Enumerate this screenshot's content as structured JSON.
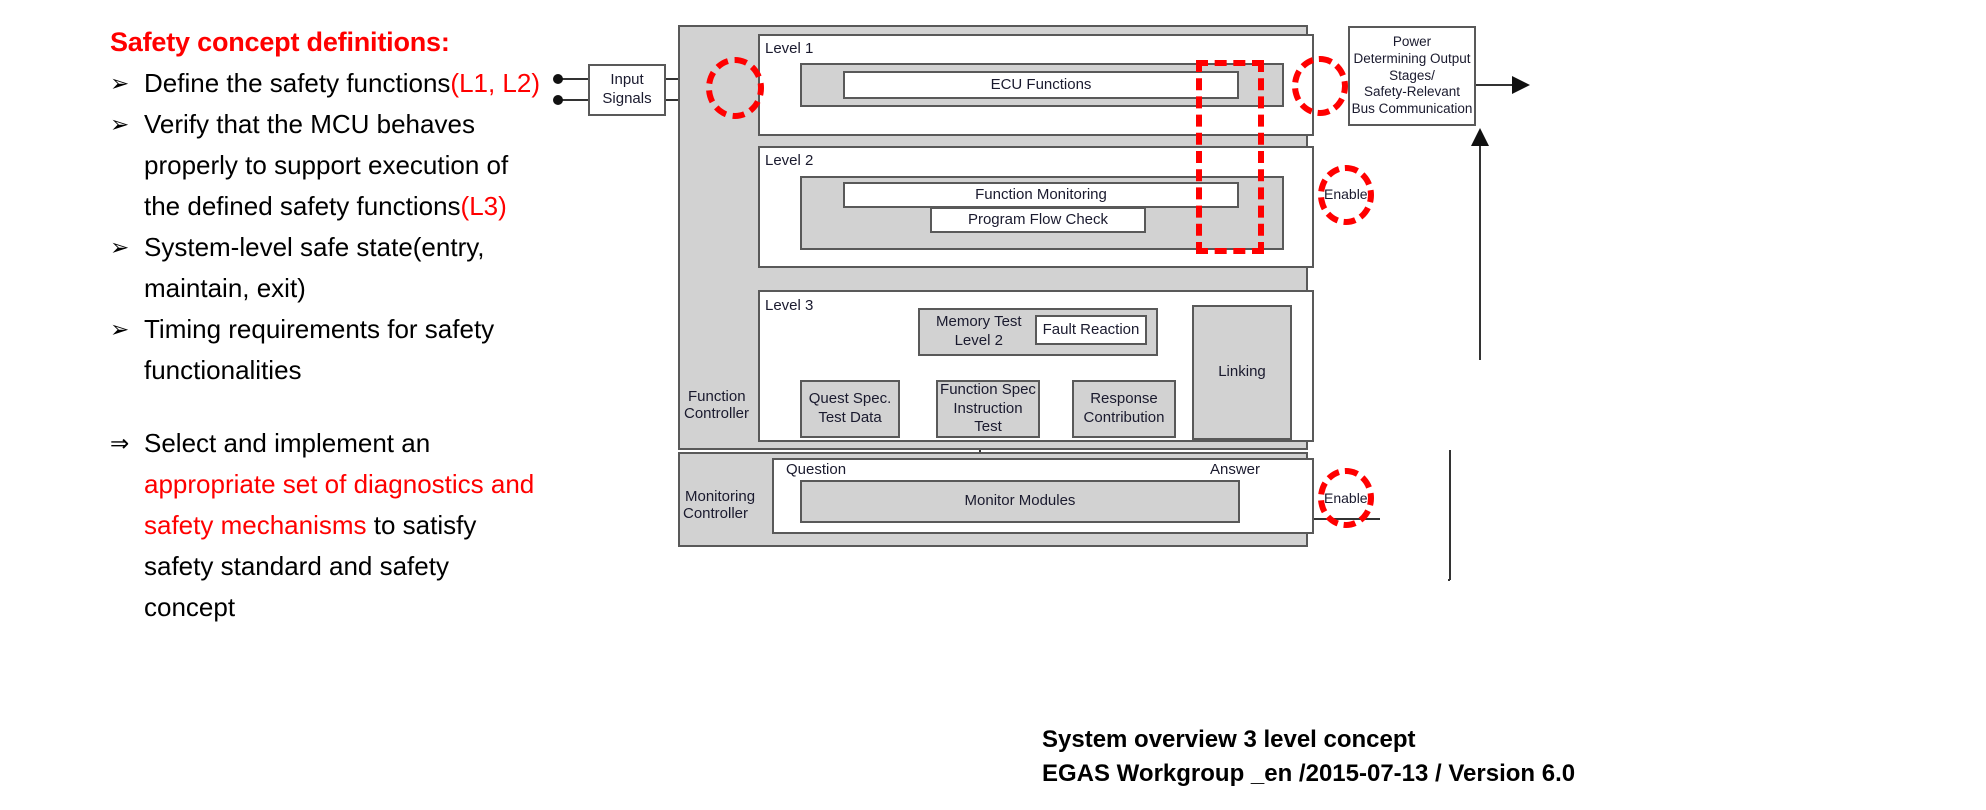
{
  "slide": {
    "heading": "Safety concept definitions:",
    "bullets": [
      {
        "marker": "➢",
        "lines": [
          {
            "parts": [
              {
                "text": "Define the safety functions",
                "color": "black"
              },
              {
                "text": "(L1, L2)",
                "color": "red"
              }
            ]
          }
        ]
      },
      {
        "marker": "➢",
        "lines": [
          {
            "parts": [
              {
                "text": "Verify that the MCU behaves",
                "color": "black"
              }
            ]
          },
          {
            "parts": [
              {
                "text": "properly to support execution of",
                "color": "black"
              }
            ]
          },
          {
            "parts": [
              {
                "text": "the defined safety functions",
                "color": "black"
              },
              {
                "text": "(L3)",
                "color": "red"
              }
            ]
          }
        ]
      },
      {
        "marker": "➢",
        "lines": [
          {
            "parts": [
              {
                "text": "System-level safe state(entry,",
                "color": "black"
              }
            ]
          },
          {
            "parts": [
              {
                "text": "maintain, exit)",
                "color": "black"
              }
            ]
          }
        ]
      },
      {
        "marker": "➢",
        "lines": [
          {
            "parts": [
              {
                "text": "Timing requirements for safety",
                "color": "black"
              }
            ]
          },
          {
            "parts": [
              {
                "text": "functionalities",
                "color": "black"
              }
            ]
          }
        ]
      }
    ],
    "conclusion": {
      "marker": "⇒",
      "lines": [
        {
          "parts": [
            {
              "text": "Select and implement an",
              "color": "black"
            }
          ]
        },
        {
          "parts": [
            {
              "text": "appropriate set of diagnostics and",
              "color": "red"
            }
          ]
        },
        {
          "parts": [
            {
              "text": "safety mechanisms",
              "color": "red"
            },
            {
              "text": " to satisfy",
              "color": "black"
            }
          ]
        },
        {
          "parts": [
            {
              "text": "safety standard and safety",
              "color": "black"
            }
          ]
        },
        {
          "parts": [
            {
              "text": "concept",
              "color": "black"
            }
          ]
        }
      ]
    }
  },
  "diagram": {
    "input_signals": "Input\nSignals",
    "input_signals_line1": "Input",
    "input_signals_line2": "Signals",
    "level1_label": "Level 1",
    "level2_label": "Level 2",
    "level3_label": "Level 3",
    "ecu_functions": "ECU Functions",
    "function_monitoring": "Function Monitoring",
    "program_flow_check": "Program Flow Check",
    "memory_test_level2_line1": "Memory Test",
    "memory_test_level2_line2": "Level 2",
    "fault_reaction": "Fault Reaction",
    "quest_spec_line1": "Quest Spec.",
    "quest_spec_line2": "Test Data",
    "function_spec_line1": "Function Spec",
    "function_spec_line2": "Instruction Test",
    "response_line1": "Response",
    "response_line2": "Contribution",
    "linking": "Linking",
    "function_controller_line1": "Function",
    "function_controller_line2": "Controller",
    "monitoring_controller_line1": "Monitoring",
    "monitoring_controller_line2": "Controller",
    "monitor_modules": "Monitor Modules",
    "question": "Question",
    "answer": "Answer",
    "enable_top": "Enable",
    "enable_bottom": "Enable",
    "power_box_line1": "Power",
    "power_box_line2": "Determining Output",
    "power_box_line3": "Stages/",
    "power_box_line4": "Safety-Relevant",
    "power_box_line5": "Bus Communication"
  },
  "caption": {
    "line1": "System overview 3 level concept",
    "line2": "EGAS Workgroup _en /2015-07-13 / Version 6.0"
  },
  "colors": {
    "accent_red": "#ff0000",
    "box_fill": "#d2d2d2",
    "box_border": "#595959",
    "text": "#1a1a2e"
  }
}
